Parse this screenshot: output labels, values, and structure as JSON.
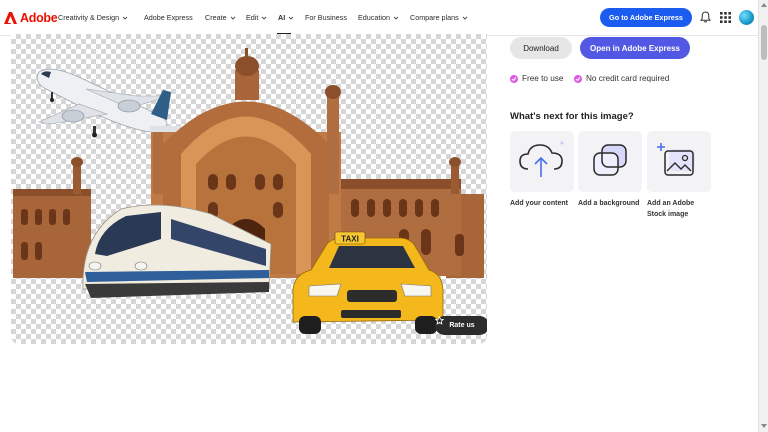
{
  "brand": {
    "name": "Adobe",
    "color": "#eb1000"
  },
  "nav": {
    "items": [
      {
        "label": "Creativity & Design",
        "has_menu": true
      },
      {
        "label": "Adobe Express",
        "has_menu": false
      },
      {
        "label": "Create",
        "has_menu": true
      },
      {
        "label": "Edit",
        "has_menu": true
      },
      {
        "label": "AI",
        "has_menu": true,
        "active": true
      },
      {
        "label": "For Business",
        "has_menu": false
      },
      {
        "label": "Education",
        "has_menu": true
      },
      {
        "label": "Compare plans",
        "has_menu": true
      }
    ],
    "cta": "Go to Adobe Express",
    "icons": [
      "bell-icon",
      "app-grid-icon",
      "avatar"
    ]
  },
  "canvas": {
    "subjects": [
      "airplane",
      "Rumi Darwaza gate",
      "high-speed train",
      "yellow taxi"
    ],
    "taxi_sign": "TAXI",
    "rate_label": "Rate us"
  },
  "panel": {
    "download_label": "Download",
    "open_label": "Open in Adobe Express",
    "features": [
      "Free to use",
      "No credit card required"
    ],
    "next_title": "What's next for this image?",
    "cards": [
      {
        "label": "Add your content",
        "icon": "cloud-upload-icon"
      },
      {
        "label": "Add a background",
        "icon": "layers-icon"
      },
      {
        "label": "Add an Adobe Stock image",
        "icon": "image-plus-icon"
      }
    ]
  },
  "colors": {
    "primary_blue": "#1b5cf0",
    "open_button": "#5258e4",
    "check_magenta": "#d95ce6",
    "taxi_yellow": "#f4b81c"
  }
}
